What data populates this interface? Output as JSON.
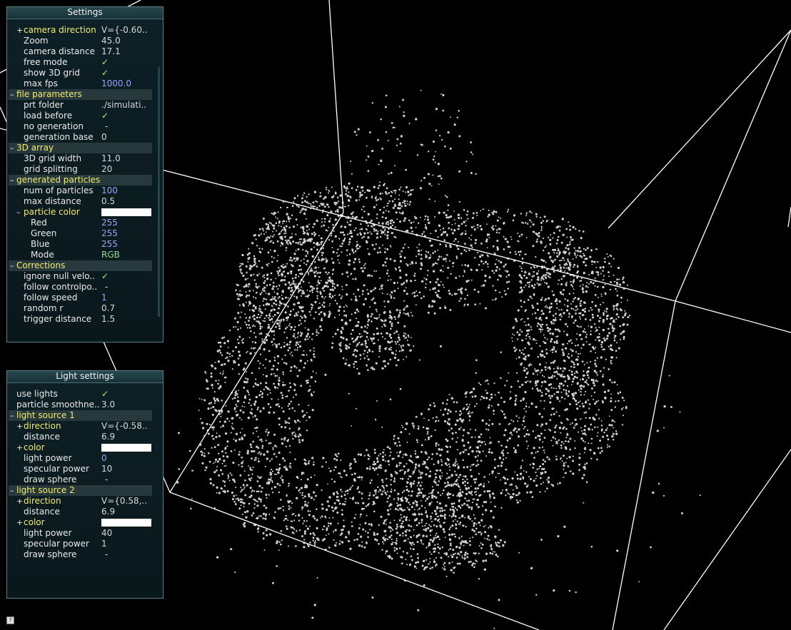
{
  "settings": {
    "title": "Settings",
    "rows": [
      {
        "label": "camera direction",
        "value": "V={-0.60..",
        "kind": "sub",
        "indent": 1,
        "toggle": "+"
      },
      {
        "label": "Zoom",
        "value": "45.0",
        "kind": "normal",
        "indent": 1
      },
      {
        "label": "camera distance",
        "value": "17.1",
        "kind": "normal",
        "indent": 1
      },
      {
        "label": "free mode",
        "value": "✓",
        "kind": "check",
        "indent": 1
      },
      {
        "label": "show 3D grid",
        "value": "✓",
        "kind": "check",
        "indent": 1
      },
      {
        "label": "max fps",
        "value": "1000.0",
        "kind": "blue",
        "indent": 1
      },
      {
        "label": "file parameters",
        "value": "",
        "kind": "group",
        "indent": 0,
        "toggle": "-"
      },
      {
        "label": "prt folder",
        "value": "./simulati..",
        "kind": "normal",
        "indent": 1
      },
      {
        "label": "load before",
        "value": "✓",
        "kind": "check",
        "indent": 1
      },
      {
        "label": "no generation",
        "value": "-",
        "kind": "dash",
        "indent": 1
      },
      {
        "label": "generation base",
        "value": "0",
        "kind": "normal",
        "indent": 1
      },
      {
        "label": "3D array",
        "value": "",
        "kind": "group",
        "indent": 0,
        "toggle": "-"
      },
      {
        "label": "3D grid width",
        "value": "11.0",
        "kind": "normal",
        "indent": 1
      },
      {
        "label": "grid splitting",
        "value": "20",
        "kind": "normal",
        "indent": 1
      },
      {
        "label": "generated particles",
        "value": "",
        "kind": "group",
        "indent": 0,
        "toggle": "-"
      },
      {
        "label": "num of particles",
        "value": "100",
        "kind": "blue",
        "indent": 1
      },
      {
        "label": "max distance",
        "value": "0.5",
        "kind": "normal",
        "indent": 1
      },
      {
        "label": "particle color",
        "value": "",
        "kind": "color",
        "indent": 1,
        "toggle": "-"
      },
      {
        "label": "Red",
        "value": "255",
        "kind": "blue",
        "indent": 2
      },
      {
        "label": "Green",
        "value": "255",
        "kind": "blue",
        "indent": 2
      },
      {
        "label": "Blue",
        "value": "255",
        "kind": "blue",
        "indent": 2
      },
      {
        "label": "Mode",
        "value": "RGB",
        "kind": "green",
        "indent": 2
      },
      {
        "label": "Corrections",
        "value": "",
        "kind": "group",
        "indent": 0,
        "toggle": "-"
      },
      {
        "label": "ignore null velo..",
        "value": "✓",
        "kind": "check",
        "indent": 1
      },
      {
        "label": "follow controlpo..",
        "value": "-",
        "kind": "dash",
        "indent": 1
      },
      {
        "label": "follow speed",
        "value": "1",
        "kind": "blue",
        "indent": 1
      },
      {
        "label": "random r",
        "value": "0.7",
        "kind": "normal",
        "indent": 1
      },
      {
        "label": "trigger distance",
        "value": "1.5",
        "kind": "normal",
        "indent": 1
      }
    ]
  },
  "light_settings": {
    "title": "Light settings",
    "rows": [
      {
        "label": "use lights",
        "value": "✓",
        "kind": "check",
        "indent": 0
      },
      {
        "label": "particle smoothne..",
        "value": "3.0",
        "kind": "normal",
        "indent": 0
      },
      {
        "label": "light source 1",
        "value": "",
        "kind": "group",
        "indent": 0,
        "toggle": "-"
      },
      {
        "label": "direction",
        "value": "V={-0.58..",
        "kind": "sub",
        "indent": 1,
        "toggle": "+"
      },
      {
        "label": "distance",
        "value": "6.9",
        "kind": "normal",
        "indent": 1
      },
      {
        "label": "color",
        "value": "",
        "kind": "color",
        "indent": 1,
        "toggle": "+"
      },
      {
        "label": "light power",
        "value": "0",
        "kind": "blue",
        "indent": 1
      },
      {
        "label": "specular power",
        "value": "10",
        "kind": "normal",
        "indent": 1
      },
      {
        "label": "draw sphere",
        "value": "-",
        "kind": "dash",
        "indent": 1
      },
      {
        "label": "light source 2",
        "value": "",
        "kind": "group",
        "indent": 0,
        "toggle": "-"
      },
      {
        "label": "direction",
        "value": "V={0.58,..",
        "kind": "sub",
        "indent": 1,
        "toggle": "+"
      },
      {
        "label": "distance",
        "value": "6.9",
        "kind": "normal",
        "indent": 1
      },
      {
        "label": "color",
        "value": "",
        "kind": "color",
        "indent": 1,
        "toggle": "+"
      },
      {
        "label": "light power",
        "value": "40",
        "kind": "normal",
        "indent": 1
      },
      {
        "label": "specular power",
        "value": "1",
        "kind": "normal",
        "indent": 1
      },
      {
        "label": "draw sphere",
        "value": "-",
        "kind": "dash",
        "indent": 1
      }
    ]
  },
  "colors": {
    "background": "#000000",
    "particle": "#d0d0d0",
    "grid_lines": "#ffffff",
    "group_label": "#f2ec6a",
    "numeric_blue": "#9aa2ff"
  },
  "help_icon": "question-icon"
}
